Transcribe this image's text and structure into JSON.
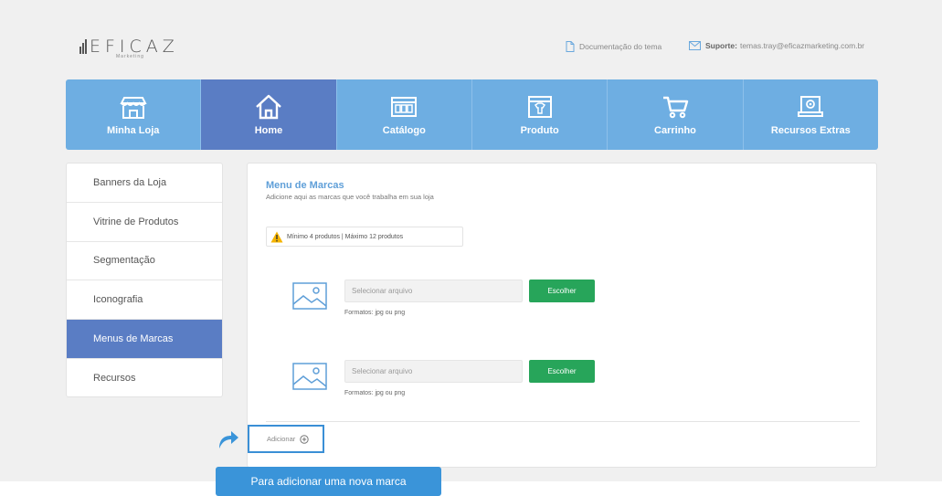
{
  "brand": {
    "name": "EFICAZ",
    "tagline": "Marketing"
  },
  "header": {
    "docs_label": "Documentação do tema",
    "support_label": "Suporte:",
    "support_email": "temas.tray@eficazmarketing.com.br"
  },
  "nav": {
    "items": [
      {
        "label": "Minha Loja",
        "icon": "store-icon"
      },
      {
        "label": "Home",
        "icon": "home-icon",
        "active": true
      },
      {
        "label": "Catálogo",
        "icon": "catalog-icon"
      },
      {
        "label": "Produto",
        "icon": "product-icon"
      },
      {
        "label": "Carrinho",
        "icon": "cart-icon"
      },
      {
        "label": "Recursos Extras",
        "icon": "extras-icon"
      }
    ]
  },
  "sidebar": {
    "items": [
      {
        "label": "Banners da Loja"
      },
      {
        "label": "Vitrine de Produtos"
      },
      {
        "label": "Segmentação"
      },
      {
        "label": "Iconografia"
      },
      {
        "label": "Menus de Marcas",
        "active": true
      },
      {
        "label": "Recursos"
      }
    ]
  },
  "main": {
    "title": "Menu de Marcas",
    "subtitle": "Adicione aqui as marcas que você trabalha em sua loja",
    "notice": "Mínimo 4 produtos | Máximo 12 produtos",
    "uploads": [
      {
        "placeholder": "Selecionar arquivo",
        "button": "Escolher",
        "formats": "Formatos: jpg ou png"
      },
      {
        "placeholder": "Selecionar arquivo",
        "button": "Escolher",
        "formats": "Formatos: jpg ou png"
      }
    ],
    "add_label": "Adicionar"
  },
  "tooltip": {
    "text": "Para adicionar uma nova marca"
  },
  "colors": {
    "nav_bg": "#6eaee2",
    "nav_active": "#5a7dc4",
    "button_green": "#27a55a",
    "accent_blue": "#3a94d9",
    "title_blue": "#5f9fd8"
  }
}
